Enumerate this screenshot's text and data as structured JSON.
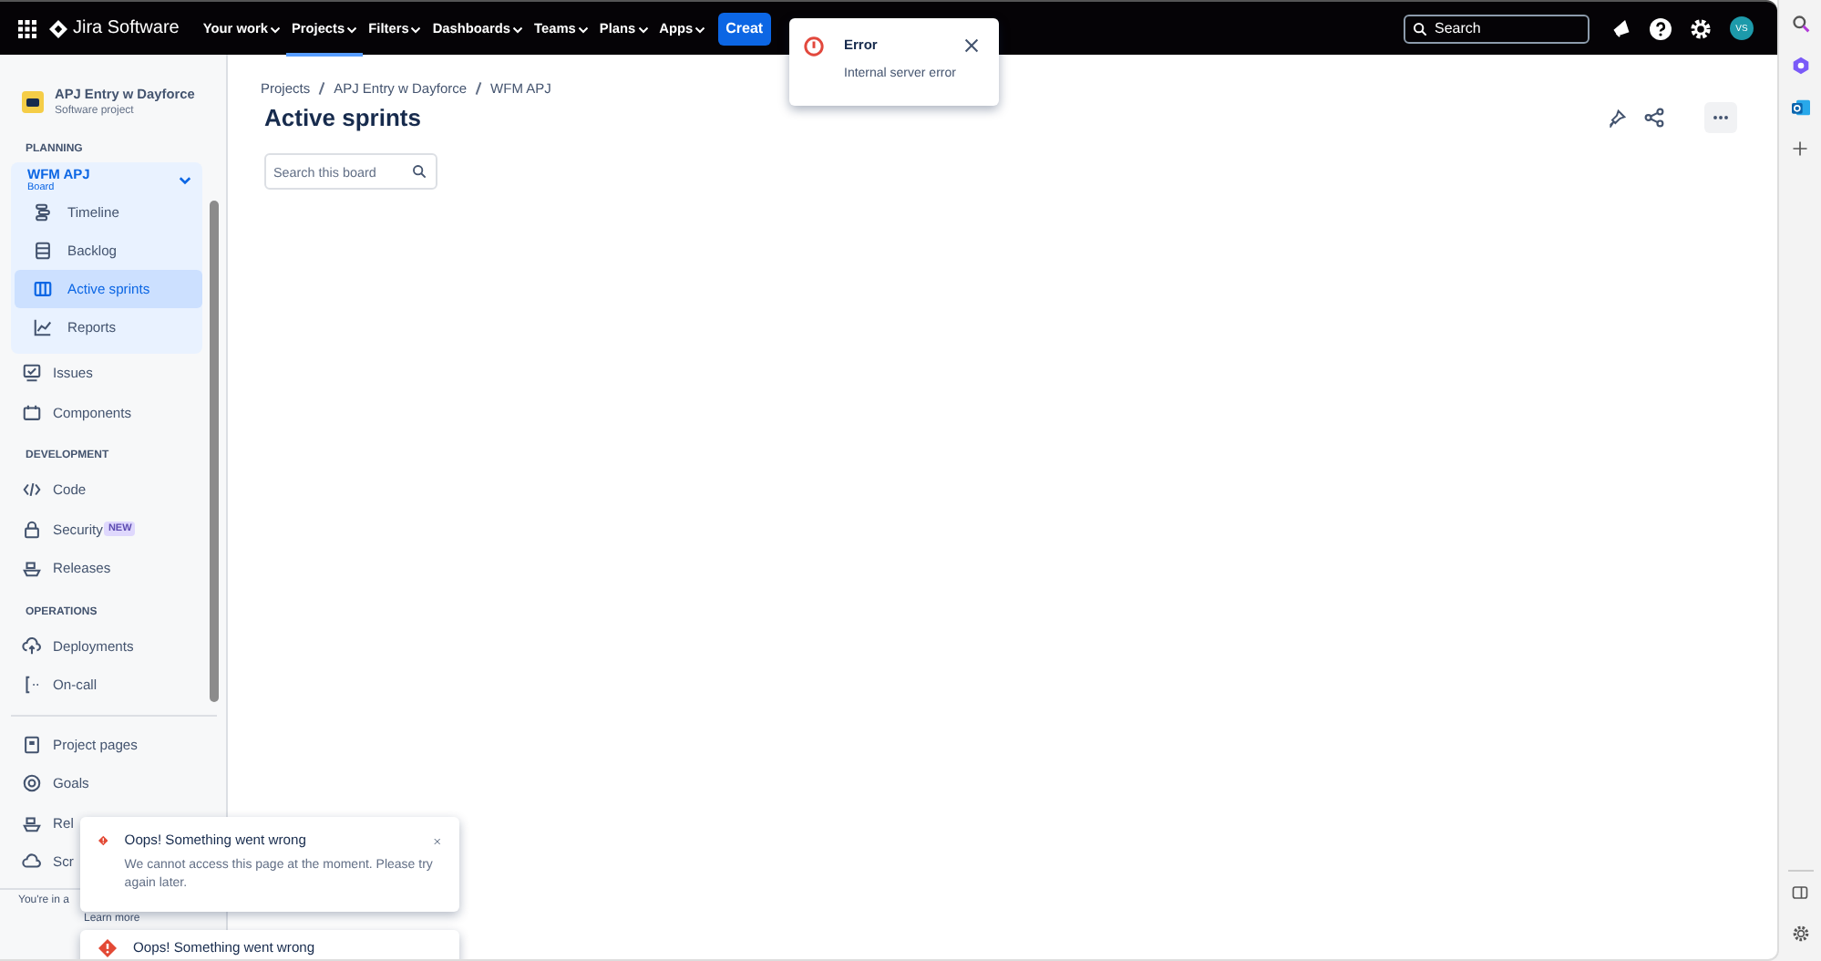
{
  "topbar": {
    "logo": "Jira Software",
    "menu": [
      {
        "label": "Your work",
        "selected": false
      },
      {
        "label": "Projects",
        "selected": true
      },
      {
        "label": "Filters",
        "selected": false
      },
      {
        "label": "Dashboards",
        "selected": false
      },
      {
        "label": "Teams",
        "selected": false
      },
      {
        "label": "Plans",
        "selected": false
      },
      {
        "label": "Apps",
        "selected": false
      }
    ],
    "create": "Creat",
    "search_placeholder": "Search",
    "avatar": "VS"
  },
  "error_popup": {
    "title": "Error",
    "message": "Internal server error"
  },
  "sidebar": {
    "project": {
      "name": "APJ Entry w Dayforce",
      "type": "Software project"
    },
    "planning_heading": "PLANNING",
    "board": {
      "name": "WFM APJ",
      "type": "Board",
      "expanded": true,
      "items": [
        {
          "label": "Timeline",
          "selected": false
        },
        {
          "label": "Backlog",
          "selected": false
        },
        {
          "label": "Active sprints",
          "selected": true
        },
        {
          "label": "Reports",
          "selected": false
        }
      ]
    },
    "sections": [
      {
        "items": [
          {
            "label": "Issues"
          },
          {
            "label": "Components"
          }
        ]
      },
      {
        "heading": "DEVELOPMENT",
        "items": [
          {
            "label": "Code"
          },
          {
            "label": "Security",
            "badge": "NEW"
          },
          {
            "label": "Releases"
          }
        ]
      },
      {
        "heading": "OPERATIONS",
        "items": [
          {
            "label": "Deployments"
          },
          {
            "label": "On-call"
          }
        ]
      },
      {
        "divider": true,
        "items": [
          {
            "label": "Project pages"
          },
          {
            "label": "Goals"
          },
          {
            "label": "Rel"
          },
          {
            "label": "Scr"
          }
        ]
      }
    ],
    "footer": {
      "text": "You're in a",
      "link": "Learn more"
    }
  },
  "main": {
    "breadcrumbs": [
      "Projects",
      "APJ Entry w Dayforce",
      "WFM APJ"
    ],
    "title": "Active sprints",
    "search_placeholder": "Search this board"
  },
  "toasts": [
    {
      "title": "Oops! Something went wrong",
      "message": "We cannot access this page at the moment. Please try again later."
    },
    {
      "title": "Oops! Something went wrong"
    }
  ]
}
